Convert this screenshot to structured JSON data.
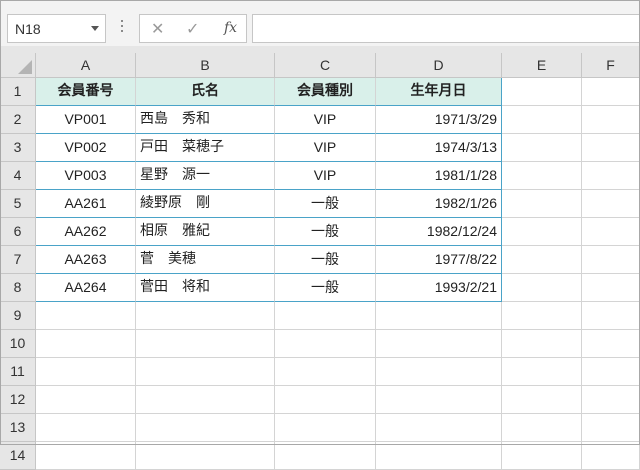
{
  "formula_bar": {
    "name_box": "N18",
    "cancel_icon": "✕",
    "enter_icon": "✓",
    "fx_label": "fx",
    "formula": ""
  },
  "columns": [
    "A",
    "B",
    "C",
    "D",
    "E",
    "F"
  ],
  "rows": [
    "1",
    "2",
    "3",
    "4",
    "5",
    "6",
    "7",
    "8",
    "9",
    "10",
    "11",
    "12",
    "13",
    "14"
  ],
  "table": {
    "headers": [
      "会員番号",
      "氏名",
      "会員種別",
      "生年月日"
    ],
    "records": [
      [
        "VP001",
        "西島　秀和",
        "VIP",
        "1971/3/29"
      ],
      [
        "VP002",
        "戸田　菜穂子",
        "VIP",
        "1974/3/13"
      ],
      [
        "VP003",
        "星野　源一",
        "VIP",
        "1981/1/28"
      ],
      [
        "AA261",
        "綾野原　剛",
        "一般",
        "1982/1/26"
      ],
      [
        "AA262",
        "相原　雅紀",
        "一般",
        "1982/12/24"
      ],
      [
        "AA263",
        "菅　美穂",
        "一般",
        "1977/8/22"
      ],
      [
        "AA264",
        "菅田　将和",
        "一般",
        "1993/2/21"
      ]
    ]
  },
  "colors": {
    "header_fill": "#d9f0ea",
    "table_border": "#4aa3c8",
    "gridline": "#d4d4d4"
  }
}
